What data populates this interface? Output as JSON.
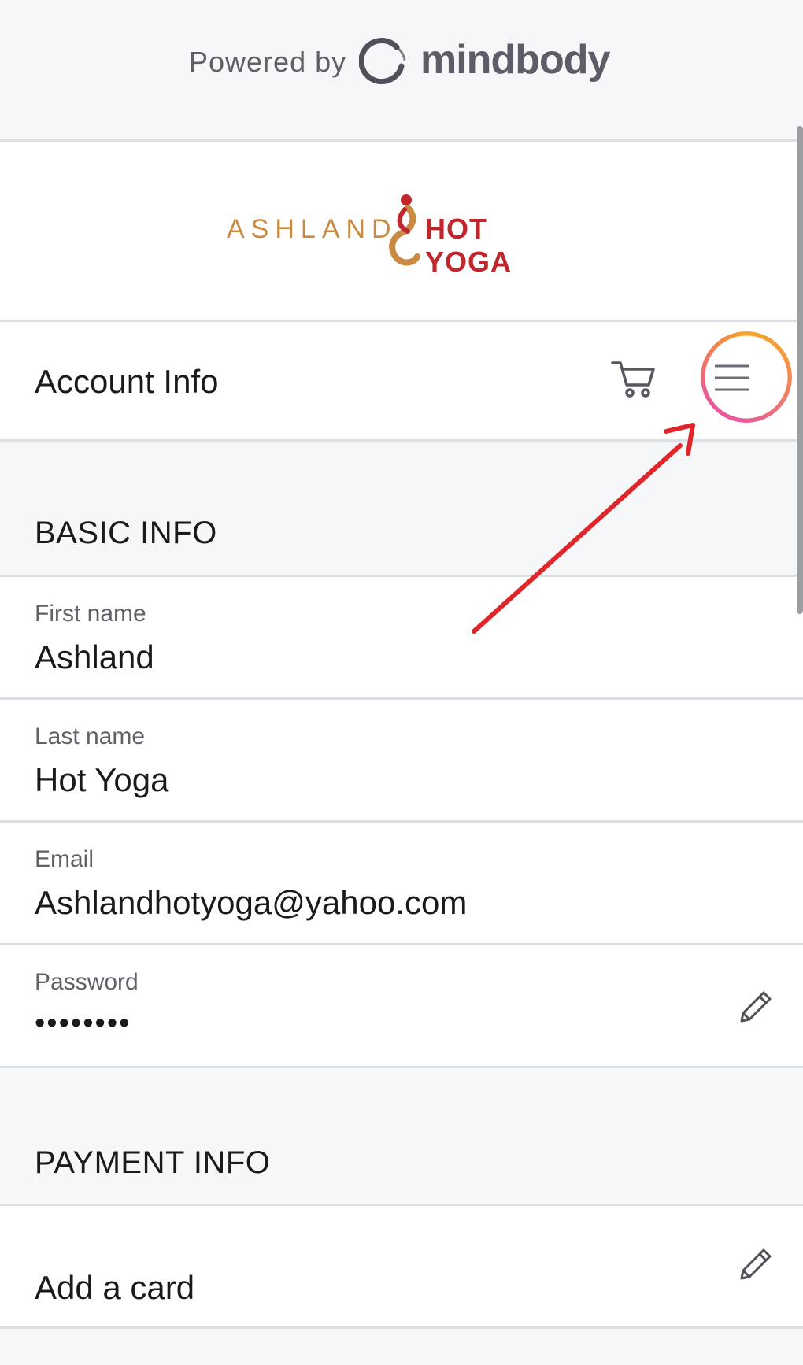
{
  "header": {
    "powered_by": "Powered by",
    "brand": "mindbody"
  },
  "studio": {
    "name_part1": "ASHLAND",
    "name_part2": "HOT YOGA"
  },
  "nav": {
    "title": "Account Info",
    "cart_icon": "cart-icon",
    "menu_icon": "hamburger-menu-icon"
  },
  "basic_info": {
    "heading": "BASIC INFO",
    "fields": [
      {
        "label": "First name",
        "value": "Ashland"
      },
      {
        "label": "Last name",
        "value": "Hot Yoga"
      },
      {
        "label": "Email",
        "value": "Ashlandhotyoga@yahoo.com"
      },
      {
        "label": "Password",
        "value": "••••••••"
      }
    ]
  },
  "payment_info": {
    "heading": "PAYMENT INFO",
    "add_card": "Add a card"
  },
  "colors": {
    "studio_gold": "#c98a43",
    "studio_red": "#c0262c",
    "annotation_arrow": "#e0262a",
    "highlight_ring_start": "#f3a52a",
    "highlight_ring_end": "#e85a98"
  }
}
